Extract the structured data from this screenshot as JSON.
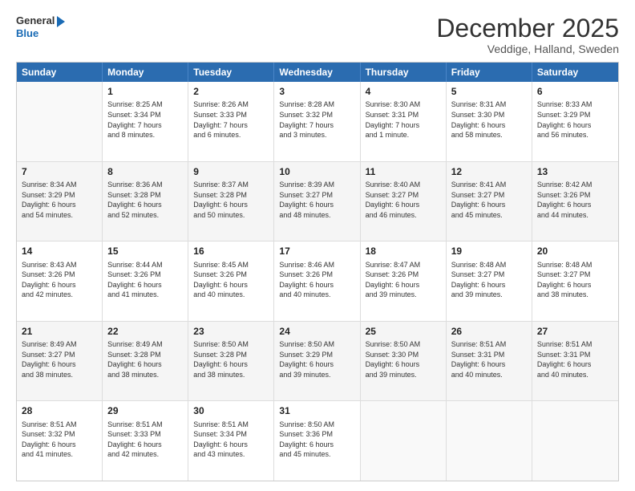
{
  "logo": {
    "line1": "General",
    "line2": "Blue"
  },
  "title": "December 2025",
  "subtitle": "Veddige, Halland, Sweden",
  "headers": [
    "Sunday",
    "Monday",
    "Tuesday",
    "Wednesday",
    "Thursday",
    "Friday",
    "Saturday"
  ],
  "weeks": [
    [
      {
        "day": "",
        "detail": ""
      },
      {
        "day": "1",
        "detail": "Sunrise: 8:25 AM\nSunset: 3:34 PM\nDaylight: 7 hours\nand 8 minutes."
      },
      {
        "day": "2",
        "detail": "Sunrise: 8:26 AM\nSunset: 3:33 PM\nDaylight: 7 hours\nand 6 minutes."
      },
      {
        "day": "3",
        "detail": "Sunrise: 8:28 AM\nSunset: 3:32 PM\nDaylight: 7 hours\nand 3 minutes."
      },
      {
        "day": "4",
        "detail": "Sunrise: 8:30 AM\nSunset: 3:31 PM\nDaylight: 7 hours\nand 1 minute."
      },
      {
        "day": "5",
        "detail": "Sunrise: 8:31 AM\nSunset: 3:30 PM\nDaylight: 6 hours\nand 58 minutes."
      },
      {
        "day": "6",
        "detail": "Sunrise: 8:33 AM\nSunset: 3:29 PM\nDaylight: 6 hours\nand 56 minutes."
      }
    ],
    [
      {
        "day": "7",
        "detail": "Sunrise: 8:34 AM\nSunset: 3:29 PM\nDaylight: 6 hours\nand 54 minutes."
      },
      {
        "day": "8",
        "detail": "Sunrise: 8:36 AM\nSunset: 3:28 PM\nDaylight: 6 hours\nand 52 minutes."
      },
      {
        "day": "9",
        "detail": "Sunrise: 8:37 AM\nSunset: 3:28 PM\nDaylight: 6 hours\nand 50 minutes."
      },
      {
        "day": "10",
        "detail": "Sunrise: 8:39 AM\nSunset: 3:27 PM\nDaylight: 6 hours\nand 48 minutes."
      },
      {
        "day": "11",
        "detail": "Sunrise: 8:40 AM\nSunset: 3:27 PM\nDaylight: 6 hours\nand 46 minutes."
      },
      {
        "day": "12",
        "detail": "Sunrise: 8:41 AM\nSunset: 3:27 PM\nDaylight: 6 hours\nand 45 minutes."
      },
      {
        "day": "13",
        "detail": "Sunrise: 8:42 AM\nSunset: 3:26 PM\nDaylight: 6 hours\nand 44 minutes."
      }
    ],
    [
      {
        "day": "14",
        "detail": "Sunrise: 8:43 AM\nSunset: 3:26 PM\nDaylight: 6 hours\nand 42 minutes."
      },
      {
        "day": "15",
        "detail": "Sunrise: 8:44 AM\nSunset: 3:26 PM\nDaylight: 6 hours\nand 41 minutes."
      },
      {
        "day": "16",
        "detail": "Sunrise: 8:45 AM\nSunset: 3:26 PM\nDaylight: 6 hours\nand 40 minutes."
      },
      {
        "day": "17",
        "detail": "Sunrise: 8:46 AM\nSunset: 3:26 PM\nDaylight: 6 hours\nand 40 minutes."
      },
      {
        "day": "18",
        "detail": "Sunrise: 8:47 AM\nSunset: 3:26 PM\nDaylight: 6 hours\nand 39 minutes."
      },
      {
        "day": "19",
        "detail": "Sunrise: 8:48 AM\nSunset: 3:27 PM\nDaylight: 6 hours\nand 39 minutes."
      },
      {
        "day": "20",
        "detail": "Sunrise: 8:48 AM\nSunset: 3:27 PM\nDaylight: 6 hours\nand 38 minutes."
      }
    ],
    [
      {
        "day": "21",
        "detail": "Sunrise: 8:49 AM\nSunset: 3:27 PM\nDaylight: 6 hours\nand 38 minutes."
      },
      {
        "day": "22",
        "detail": "Sunrise: 8:49 AM\nSunset: 3:28 PM\nDaylight: 6 hours\nand 38 minutes."
      },
      {
        "day": "23",
        "detail": "Sunrise: 8:50 AM\nSunset: 3:28 PM\nDaylight: 6 hours\nand 38 minutes."
      },
      {
        "day": "24",
        "detail": "Sunrise: 8:50 AM\nSunset: 3:29 PM\nDaylight: 6 hours\nand 39 minutes."
      },
      {
        "day": "25",
        "detail": "Sunrise: 8:50 AM\nSunset: 3:30 PM\nDaylight: 6 hours\nand 39 minutes."
      },
      {
        "day": "26",
        "detail": "Sunrise: 8:51 AM\nSunset: 3:31 PM\nDaylight: 6 hours\nand 40 minutes."
      },
      {
        "day": "27",
        "detail": "Sunrise: 8:51 AM\nSunset: 3:31 PM\nDaylight: 6 hours\nand 40 minutes."
      }
    ],
    [
      {
        "day": "28",
        "detail": "Sunrise: 8:51 AM\nSunset: 3:32 PM\nDaylight: 6 hours\nand 41 minutes."
      },
      {
        "day": "29",
        "detail": "Sunrise: 8:51 AM\nSunset: 3:33 PM\nDaylight: 6 hours\nand 42 minutes."
      },
      {
        "day": "30",
        "detail": "Sunrise: 8:51 AM\nSunset: 3:34 PM\nDaylight: 6 hours\nand 43 minutes."
      },
      {
        "day": "31",
        "detail": "Sunrise: 8:50 AM\nSunset: 3:36 PM\nDaylight: 6 hours\nand 45 minutes."
      },
      {
        "day": "",
        "detail": ""
      },
      {
        "day": "",
        "detail": ""
      },
      {
        "day": "",
        "detail": ""
      }
    ]
  ]
}
